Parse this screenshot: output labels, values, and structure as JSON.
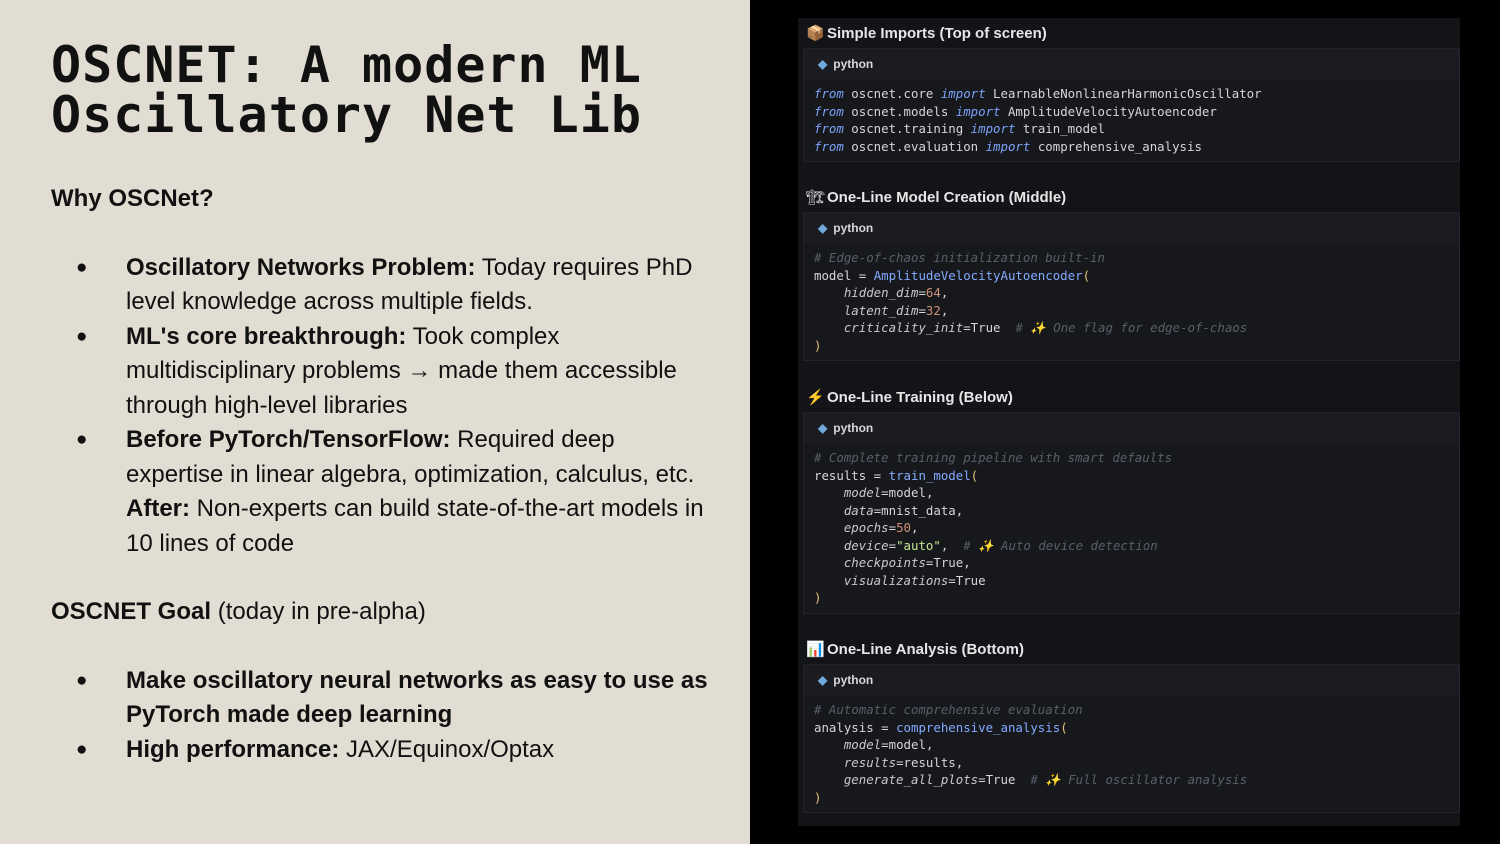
{
  "left": {
    "title_line1": "OSCNET: A modern ML",
    "title_line2": "Oscillatory Net Lib",
    "why_heading": "Why OSCNet?",
    "why_items": [
      {
        "bold": "Oscillatory Networks Problem:",
        "text": " Today requires PhD level knowledge across multiple fields."
      },
      {
        "bold": "ML's core breakthrough:",
        "text": " Took complex multidisciplinary problems → made them accessible through high-level libraries"
      },
      {
        "bold": "Before PyTorch/TensorFlow:",
        "text": " Required deep expertise in linear algebra, optimization, calculus, etc. ",
        "bold2": "After:",
        "text2": " Non-experts can build state-of-the-art models in 10 lines of code"
      }
    ],
    "goal_heading_bold": "OSCNET Goal",
    "goal_heading_rest": " (today in pre-alpha)",
    "goal_items": [
      {
        "bold": "Make oscillatory neural networks as easy to use as PyTorch made deep learning",
        "text": ""
      },
      {
        "bold": "High performance:",
        "text": " JAX/Equinox/Optax"
      }
    ],
    "bullet": "●"
  },
  "right": {
    "lang_label": "python",
    "sections": [
      {
        "emoji": "📦",
        "title": "Simple Imports (Top of screen)"
      },
      {
        "emoji": "🏗",
        "title": "One-Line Model Creation (Middle)"
      },
      {
        "emoji": "⚡",
        "title": "One-Line Training (Below)"
      },
      {
        "emoji": "📊",
        "title": "One-Line Analysis (Bottom)"
      }
    ],
    "code": {
      "imports": [
        [
          "from",
          " oscnet.core ",
          "import",
          " LearnableNonlinearHarmonicOscillator"
        ],
        [
          "from",
          " oscnet.models ",
          "import",
          " AmplitudeVelocityAutoencoder"
        ],
        [
          "from",
          " oscnet.training ",
          "import",
          " train_model"
        ],
        [
          "from",
          " oscnet.evaluation ",
          "import",
          " comprehensive_analysis"
        ]
      ],
      "model": {
        "comment": "# Edge-of-chaos initialization built-in",
        "lhs": "model = ",
        "fn": "AmplitudeVelocityAutoencoder",
        "args": [
          {
            "name": "hidden_dim",
            "value": "64",
            "suffix": ","
          },
          {
            "name": "latent_dim",
            "value": "32",
            "suffix": ","
          },
          {
            "name": "criticality_init",
            "value": "True",
            "suffix": "",
            "comment": "# ✨ One flag for edge-of-chaos"
          }
        ]
      },
      "training": {
        "comment": "# Complete training pipeline with smart defaults",
        "lhs": "results = ",
        "fn": "train_model",
        "args": [
          {
            "name": "model",
            "value": "model",
            "suffix": ","
          },
          {
            "name": "data",
            "value": "mnist_data",
            "suffix": ","
          },
          {
            "name": "epochs",
            "value": "50",
            "suffix": ","
          },
          {
            "name": "device",
            "value": "\"auto\"",
            "suffix": ",",
            "comment": "# ✨ Auto device detection"
          },
          {
            "name": "checkpoints",
            "value": "True",
            "suffix": ","
          },
          {
            "name": "visualizations",
            "value": "True",
            "suffix": ""
          }
        ]
      },
      "analysis": {
        "comment": "# Automatic comprehensive evaluation",
        "lhs": "analysis = ",
        "fn": "comprehensive_analysis",
        "args": [
          {
            "name": "model",
            "value": "model",
            "suffix": ","
          },
          {
            "name": "results",
            "value": "results",
            "suffix": ","
          },
          {
            "name": "generate_all_plots",
            "value": "True",
            "suffix": "",
            "comment": "# ✨ Full oscillator analysis"
          }
        ]
      }
    }
  }
}
